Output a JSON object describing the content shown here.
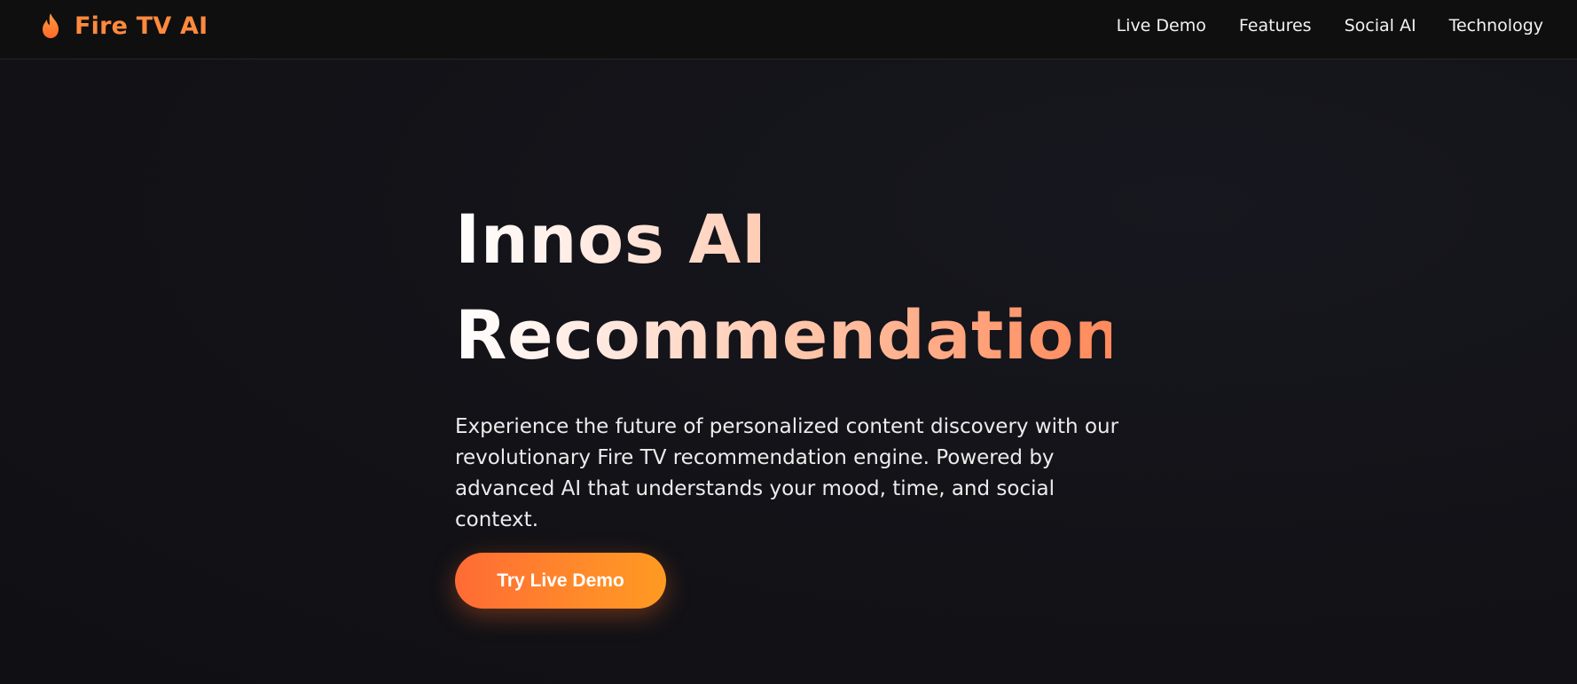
{
  "navbar": {
    "brand": {
      "icon": "flame-icon",
      "name": "Fire TV AI",
      "color": "#ff8a3d"
    },
    "links": [
      {
        "label": "Live Demo"
      },
      {
        "label": "Features"
      },
      {
        "label": "Social AI"
      },
      {
        "label": "Technology"
      }
    ]
  },
  "hero": {
    "title_line1": "Innos AI",
    "title_line2": "Recommendations",
    "description": "Experience the future of personalized content discovery with our revolutionary Fire TV recommendation engine. Powered by advanced AI that understands your mood, time, and social context.",
    "cta_label": "Try Live Demo"
  },
  "colors": {
    "accent": "#ff6b35",
    "accent_end": "#ff9a22",
    "background": "#121216",
    "navbar_background": "#0f0f10"
  }
}
